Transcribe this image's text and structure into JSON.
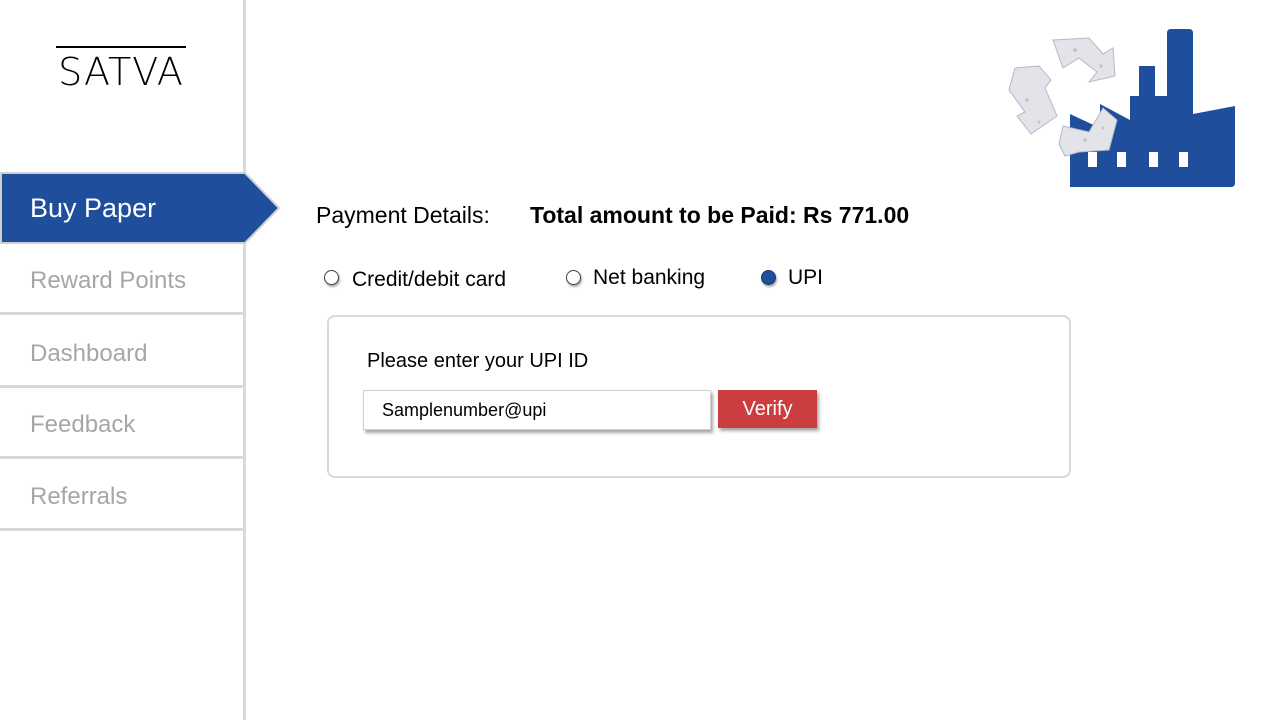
{
  "brand": {
    "logo_text": "SATVA"
  },
  "sidebar": {
    "items": [
      {
        "label": "Buy Paper",
        "active": true
      },
      {
        "label": "Reward Points",
        "active": false
      },
      {
        "label": "Dashboard",
        "active": false
      },
      {
        "label": "Feedback",
        "active": false
      },
      {
        "label": "Referrals",
        "active": false
      }
    ]
  },
  "payment": {
    "label": "Payment Details:",
    "total_text": "Total amount to be Paid: Rs  771.00"
  },
  "methods": [
    {
      "label": "Credit/debit card",
      "selected": false
    },
    {
      "label": "Net banking",
      "selected": false
    },
    {
      "label": "UPI",
      "selected": true
    }
  ],
  "upi": {
    "prompt": "Please enter your UPI ID",
    "value": "Samplenumber@upi",
    "verify_label": "Verify"
  },
  "icons": {
    "header_illustration": "recycling-factory-icon"
  },
  "colors": {
    "primary": "#1f4e9c",
    "verify": "#cc3d3f",
    "inactive_text": "#a6a6a6",
    "divider": "#d9d9d9"
  }
}
